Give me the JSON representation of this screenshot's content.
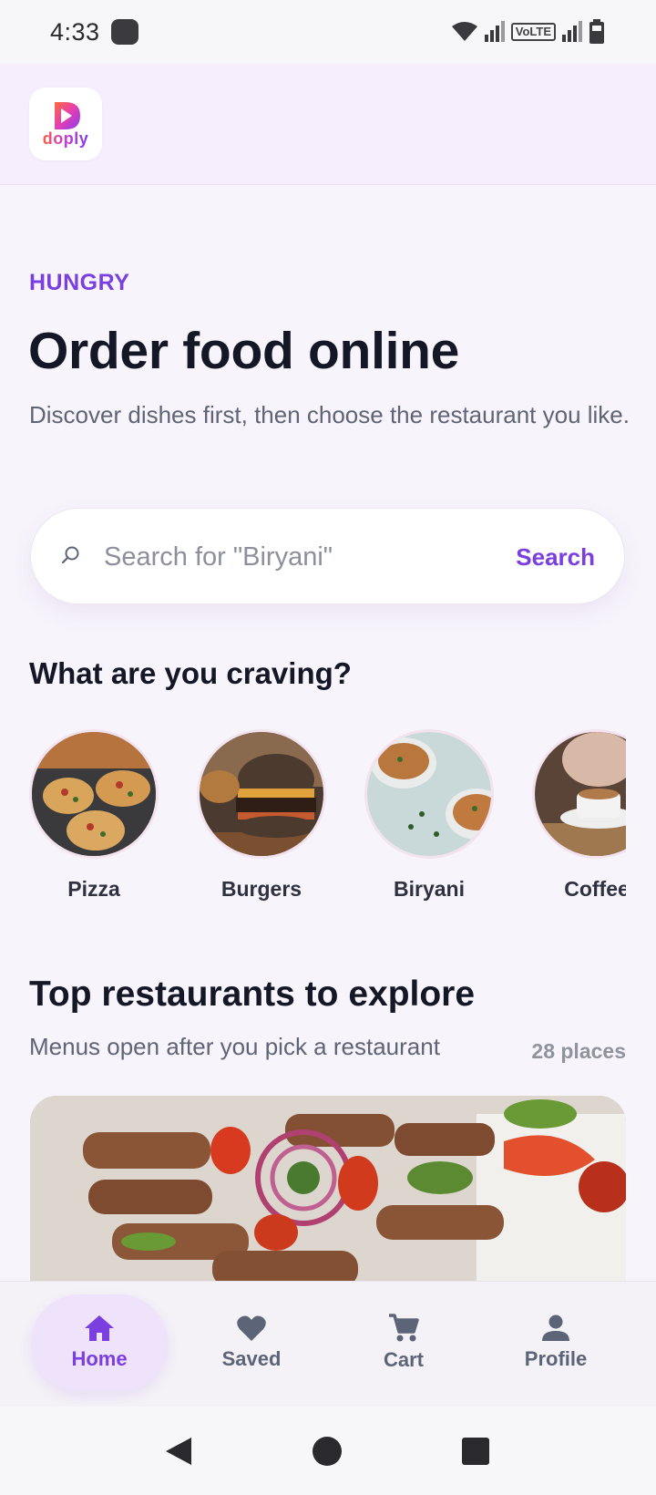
{
  "status_bar": {
    "time": "4:33",
    "network_label": "VoLTE",
    "icons": [
      "wifi-icon",
      "signal-icon",
      "volte-icon",
      "signal-icon",
      "battery-icon"
    ]
  },
  "header": {
    "logo_text": "doply",
    "logo_icon": "play-icon"
  },
  "hero": {
    "eyebrow": "HUNGRY",
    "title": "Order food online",
    "subtitle": "Discover dishes first, then choose the restaurant you like."
  },
  "search": {
    "icon": "search-icon",
    "placeholder": "Search for \"Biryani\"",
    "value": "",
    "button_label": "Search"
  },
  "cravings": {
    "title": "What are you craving?",
    "items": [
      {
        "label": "Pizza",
        "image": "pizza-photo"
      },
      {
        "label": "Burgers",
        "image": "burger-photo"
      },
      {
        "label": "Biryani",
        "image": "biryani-photo"
      },
      {
        "label": "Coffee",
        "image": "coffee-photo"
      }
    ]
  },
  "restaurants": {
    "title": "Top restaurants to explore",
    "subtitle": "Menus open after you pick a restaurant",
    "count": "28 places",
    "cards": [
      {
        "image": "kebab-platter-photo"
      }
    ]
  },
  "bottom_nav": {
    "items": [
      {
        "label": "Home",
        "icon": "home-icon",
        "active": true
      },
      {
        "label": "Saved",
        "icon": "heart-icon",
        "active": false
      },
      {
        "label": "Cart",
        "icon": "cart-icon",
        "active": false
      },
      {
        "label": "Profile",
        "icon": "person-icon",
        "active": false
      }
    ]
  },
  "system_nav": {
    "buttons": [
      "back-icon",
      "home-circle-icon",
      "recents-icon"
    ]
  },
  "colors": {
    "accent": "#7b3fe0",
    "background": "#f8f4fc",
    "header_bg": "#f6eefc",
    "text_primary": "#141826",
    "text_secondary": "#5f6475"
  }
}
